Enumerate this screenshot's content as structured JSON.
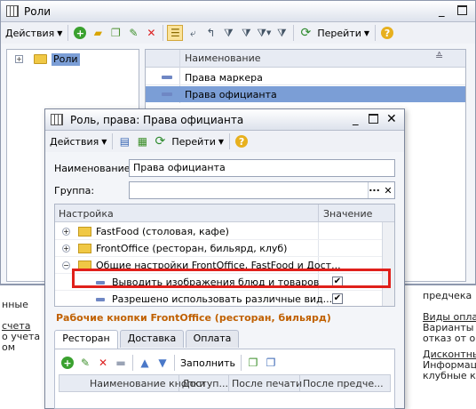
{
  "main_window": {
    "title": "Роли",
    "toolbar": {
      "actions_label": "Действия",
      "goto_label": "Перейти"
    },
    "tree": {
      "root_label": "Роли"
    },
    "list": {
      "column_header": "Наименование",
      "rows": [
        "Права маркера",
        "Права официанта"
      ]
    }
  },
  "background_partial": {
    "left_lines": [
      "нные",
      "",
      "счета",
      "о учета",
      "ом"
    ],
    "right_lines": [
      "предчека",
      "Виды оплат",
      "Варианты о",
      "отказ от опл",
      "Дисконтны",
      "Информаци",
      "клубные кар"
    ]
  },
  "dialog": {
    "title": "Роль, права: Права официанта",
    "toolbar": {
      "actions_label": "Действия",
      "goto_label": "Перейти"
    },
    "name_label": "Наименование:",
    "name_value": "Права официанта",
    "group_label": "Группа:",
    "group_value": "",
    "settings_table": {
      "col_setting": "Настройка",
      "col_value": "Значение",
      "rows": [
        {
          "label": "FastFood (столовая, кафе)"
        },
        {
          "label": "FrontOffice (ресторан, бильярд, клуб)"
        },
        {
          "label": "Общие настройки FrontOffice, FastFood и Дост..."
        },
        {
          "label": "Выводить изображения блюд и товаров",
          "value": "✔"
        },
        {
          "label": "Разрешено использовать различные вид...",
          "value": "✔"
        }
      ]
    },
    "section_title": "Рабочие кнопки FrontOffice (ресторан, бильярд)",
    "tabs": [
      "Ресторан",
      "Доставка",
      "Оплата"
    ],
    "tab_toolbar": {
      "fill_label": "Заполнить"
    },
    "buttons_table": {
      "columns": [
        "Наименование кнопки",
        "Доступ...",
        "После печати",
        "После предче..."
      ]
    }
  },
  "colors": {
    "highlight_box": "#e0201b",
    "selected_row": "#7b9ed6",
    "section_title": "#c06000"
  }
}
